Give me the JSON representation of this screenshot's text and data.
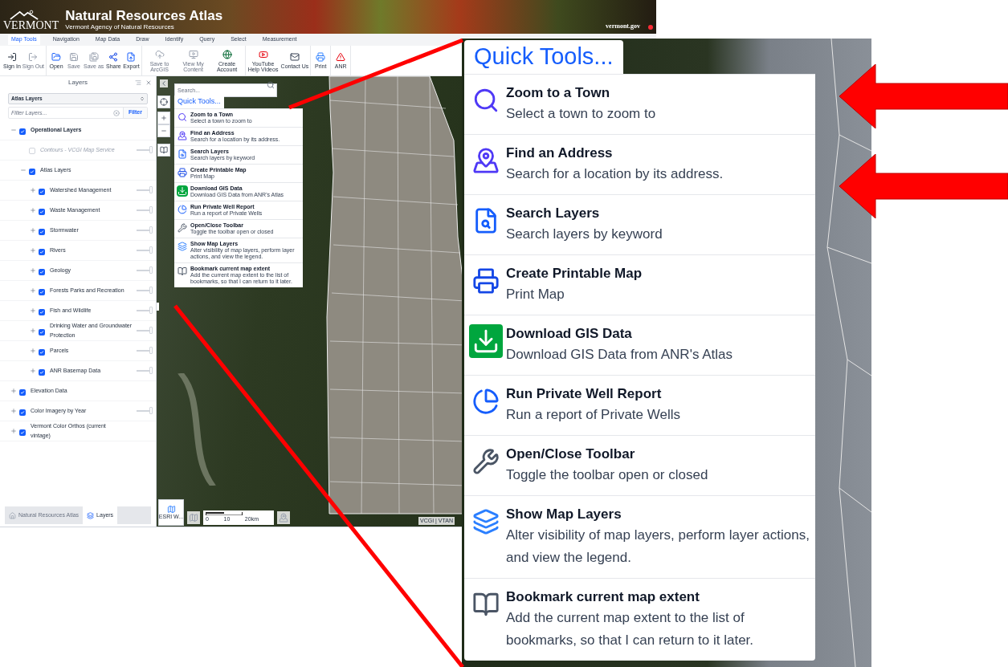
{
  "header": {
    "logo": "VERMONT",
    "title": "Natural Resources Atlas",
    "subtitle": "Vermont Agency of Natural Resources",
    "site": "vermont.gov"
  },
  "menu_tabs": [
    {
      "label": "Map Tools",
      "selected": true
    },
    {
      "label": "Navigation",
      "selected": false
    },
    {
      "label": "Map Data",
      "selected": false
    },
    {
      "label": "Draw",
      "selected": false
    },
    {
      "label": "Identify",
      "selected": false
    },
    {
      "label": "Query",
      "selected": false
    },
    {
      "label": "Select",
      "selected": false
    },
    {
      "label": "Measurement",
      "selected": false
    }
  ],
  "toolbar": [
    {
      "buttons": [
        {
          "label": "Sign In",
          "disabled": false
        },
        {
          "label": "Sign Out",
          "disabled": true
        }
      ]
    },
    {
      "buttons": [
        {
          "label": "Open",
          "disabled": false
        },
        {
          "label": "Save",
          "disabled": true
        },
        {
          "label": "Save as",
          "disabled": true
        },
        {
          "label": "Share",
          "disabled": false
        },
        {
          "label": "Export",
          "disabled": false
        }
      ]
    },
    {
      "buttons": [
        {
          "label": "Save to ArcGIS",
          "disabled": true
        },
        {
          "label": "View My Content",
          "disabled": true
        },
        {
          "label": "Create Account",
          "disabled": false
        }
      ]
    },
    {
      "buttons": [
        {
          "label": "YouTube Help Videos",
          "disabled": false
        },
        {
          "label": "Contact Us",
          "disabled": false
        }
      ]
    },
    {
      "buttons": [
        {
          "label": "Print",
          "disabled": false
        }
      ]
    },
    {
      "buttons": [
        {
          "label": "ANR",
          "disabled": false
        }
      ]
    }
  ],
  "layers_panel": {
    "title": "Layers",
    "layer_set": "Atlas Layers",
    "filter": {
      "placeholder": "Filter Layers...",
      "button": "Filter"
    },
    "tree": [
      {
        "label": "Operational Layers",
        "kind": "group",
        "expanded": true,
        "checked": true,
        "disabled": false,
        "children": [
          {
            "label": "Contours - VCGI Map Service",
            "kind": "leaf",
            "checked": false,
            "disabled": true,
            "level": 1
          },
          {
            "label": "Atlas Layers",
            "kind": "group",
            "expanded": true,
            "checked": true,
            "disabled": false,
            "children": [
              {
                "label": "Watershed Management",
                "kind": "group",
                "expanded": false,
                "checked": true,
                "disabled": false,
                "level": 1
              },
              {
                "label": "Waste Management",
                "kind": "group",
                "expanded": false,
                "checked": true,
                "disabled": false,
                "level": 1
              },
              {
                "label": "Stormwater",
                "kind": "group",
                "expanded": false,
                "checked": true,
                "disabled": false,
                "level": 1
              },
              {
                "label": "Rivers",
                "kind": "group",
                "expanded": false,
                "checked": true,
                "disabled": false,
                "level": 1
              },
              {
                "label": "Geology",
                "kind": "group",
                "expanded": false,
                "checked": true,
                "disabled": false,
                "level": 1
              },
              {
                "label": "Forests Parks and Recreation",
                "kind": "group",
                "expanded": false,
                "checked": true,
                "disabled": false,
                "level": 1
              },
              {
                "label": "Fish and Wildlife",
                "kind": "group",
                "expanded": false,
                "checked": true,
                "disabled": false,
                "level": 1
              },
              {
                "label": "Drinking Water and Groundwater Protection",
                "kind": "group",
                "expanded": false,
                "checked": true,
                "disabled": false,
                "level": 1
              },
              {
                "label": "Parcels",
                "kind": "group",
                "expanded": false,
                "checked": true,
                "disabled": false,
                "level": 1
              },
              {
                "label": "ANR Basemap Data",
                "kind": "group",
                "expanded": false,
                "checked": true,
                "disabled": false,
                "level": 1
              }
            ]
          }
        ]
      },
      {
        "label": "Elevation Data",
        "kind": "group",
        "expanded": false,
        "checked": true,
        "disabled": false
      },
      {
        "label": "Color Imagery by Year",
        "kind": "group",
        "expanded": false,
        "checked": true,
        "disabled": false,
        "level": 1
      },
      {
        "label": "Vermont Color Orthos (current vintage)",
        "kind": "group",
        "expanded": false,
        "checked": true,
        "disabled": false
      }
    ]
  },
  "map": {
    "search": {
      "placeholder": "Search..."
    },
    "quick_tools": {
      "title": "Quick Tools...",
      "items": [
        {
          "title": "Zoom to a Town",
          "description": "Select a town to zoom to"
        },
        {
          "title": "Find an Address",
          "description": "Search for a location by its address."
        },
        {
          "title": "Search Layers",
          "description": "Search layers by keyword"
        },
        {
          "title": "Create Printable Map",
          "description": "Print Map"
        },
        {
          "title": "Download GIS Data",
          "description": "Download GIS Data from ANR's Atlas"
        },
        {
          "title": "Run Private Well Report",
          "description": "Run a report of Private Wells"
        },
        {
          "title": "Open/Close Toolbar",
          "description": "Toggle the toolbar open or closed"
        },
        {
          "title": "Show Map Layers",
          "description": "Alter visibility of map layers, perform layer actions, and view the legend."
        },
        {
          "title": "Bookmark current map extent",
          "description": "Add the current map extent to the list of bookmarks, so that I can return to it later."
        }
      ]
    },
    "basemap": "ESRI W...",
    "scale_labels": [
      "0",
      "10",
      "20km"
    ],
    "attribution": "VCGI | VTAN"
  },
  "bottom_tabs": [
    {
      "label": "Natural Resources Atlas",
      "selected": false
    },
    {
      "label": "Layers",
      "selected": true
    }
  ],
  "callout": {
    "title": "Quick Tools...",
    "items": [
      {
        "title": "Zoom to a Town",
        "description": "Select a town to zoom to"
      },
      {
        "title": "Find an Address",
        "description": "Search for a location by its address."
      },
      {
        "title": "Search Layers",
        "description": "Search layers by keyword"
      },
      {
        "title": "Create Printable Map",
        "description": "Print Map"
      },
      {
        "title": "Download GIS Data",
        "description": "Download GIS Data from ANR's Atlas"
      },
      {
        "title": "Run Private Well Report",
        "description": "Run a report of Private Wells"
      },
      {
        "title": "Open/Close Toolbar",
        "description": "Toggle the toolbar open or closed"
      },
      {
        "title": "Show Map Layers",
        "description": "Alter visibility of map layers, perform layer actions, and view the legend."
      },
      {
        "title": "Bookmark current map extent",
        "description": "Add the current map extent to the list of bookmarks, so that I can return to it later."
      }
    ]
  }
}
